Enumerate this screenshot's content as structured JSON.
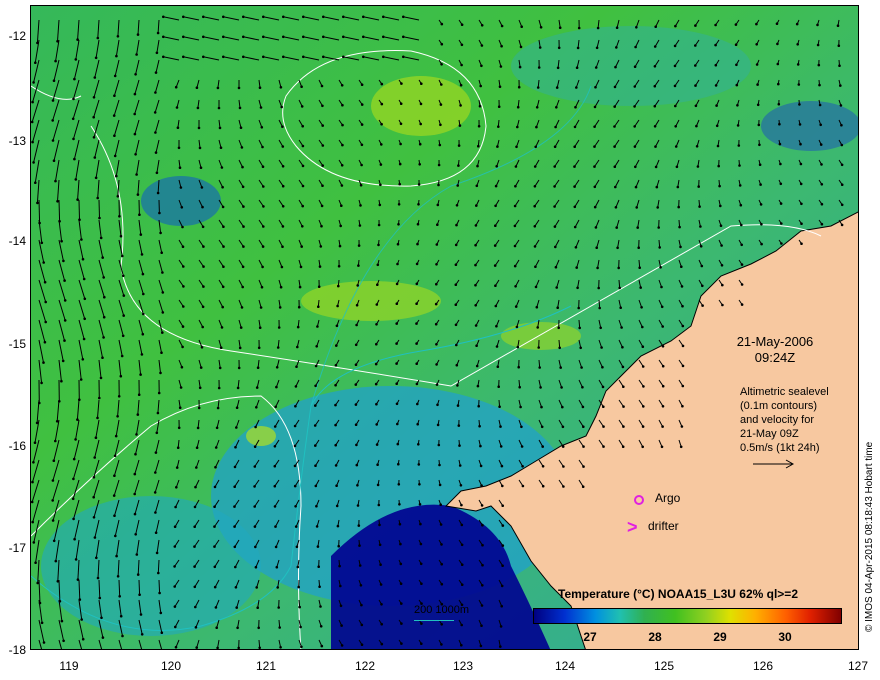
{
  "map": {
    "lat_labels": [
      "-12",
      "-13",
      "-14",
      "-15",
      "-16",
      "-17",
      "-18"
    ],
    "lon_labels": [
      "119",
      "120",
      "121",
      "122",
      "123",
      "124",
      "125",
      "126",
      "127"
    ],
    "lat_range": [
      -18,
      -11.85
    ],
    "lon_range": [
      118.7,
      127
    ],
    "colors": {
      "land": "#f7c8a0",
      "sst_mid": "#3cc060",
      "sst_warm": "#b0e020",
      "sst_cool": "#2090d0",
      "deep_cool": "#000080",
      "contour": "#ffffff",
      "isobath": "#20c0c0",
      "marker": "#e020e0"
    }
  },
  "annotation": {
    "date": "21-May-2006",
    "time": "09:24Z",
    "legend_lines": [
      "Altimetric sealevel",
      "(0.1m contours)",
      "and velocity for",
      "21-May 09Z",
      "0.5m/s (1kt 24h)"
    ],
    "argo_label": "Argo",
    "drifter_label": "drifter",
    "drifter_symbol": ">"
  },
  "colorbar": {
    "title": "Temperature (°C) NOAA15_L3U 62% ql>=2",
    "labels": [
      "27",
      "28",
      "29",
      "30"
    ]
  },
  "depth_legend": "200  1000m",
  "credit": "© IMOS 04-Apr-2015 08:18:43 Hobart time"
}
